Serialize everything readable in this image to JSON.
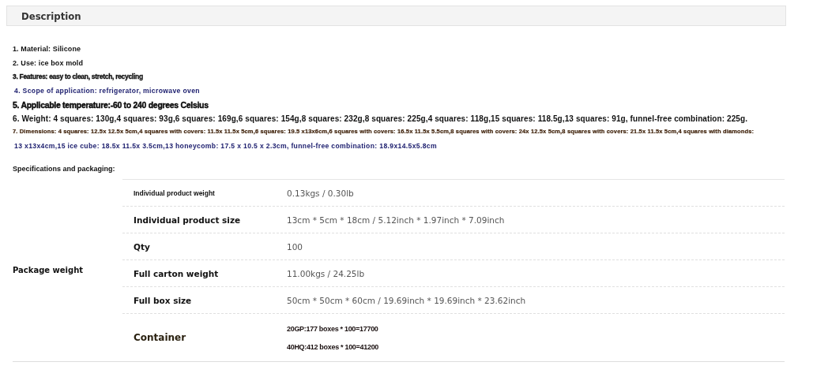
{
  "header": {
    "title": "Description"
  },
  "features": [
    {
      "kind": "plain",
      "text": "1. Material: Silicone"
    },
    {
      "kind": "plain",
      "text": "2. Use: ice box mold"
    },
    {
      "kind": "heavy",
      "text": "3. Features: easy to clean, stretch, recycling"
    },
    {
      "kind": "navy",
      "text": "4. Scope of application: refrigerator, microwave oven"
    },
    {
      "kind": "large",
      "text": "5. Applicable temperature:-60 to 240 degrees Celsius"
    },
    {
      "kind": "regular",
      "text": "6. Weight: 4 squares: 130g,4 squares: 93g,6 squares: 169g,6 squares: 154g,8 squares: 232g,8 squares: 225g,4 squares: 118g,15 squares: 118.5g,13 squares: 91g, funnel-free combination: 225g."
    },
    {
      "kind": "tiny",
      "text": "7. Dimensions: 4 squares: 12.5x 12.5x 5cm,4 squares with covers: 11.5x 11.5x 5cm,6 squares: 19.5 x13x6cm,6 squares with covers: 16.5x 11.5x 5.5cm,8 squares with covers: 24x 12.5x 5cm,8 squares with covers: 21.5x 11.5x 5cm,4 squares with diamonds:"
    },
    {
      "kind": "navy",
      "text": "13 x13x4cm,15 ice cube: 18.5x 11.5x 3.5cm,13 honeycomb: 17.5 x 10.5 x 2.3cm, funnel-free combination: 18.9x14.5x5.8cm"
    }
  ],
  "specs": {
    "heading": "Specifications and packaging:",
    "group_label": "Package weight",
    "rows": [
      {
        "kind": "small",
        "label": "Individual product weight",
        "values": [
          "0.13kgs / 0.30lb"
        ]
      },
      {
        "kind": "normal",
        "label": "Individual product size",
        "values": [
          "13cm * 5cm * 18cm / 5.12inch * 1.97inch * 7.09inch"
        ]
      },
      {
        "kind": "normal",
        "label": "Qty",
        "values": [
          "100"
        ]
      },
      {
        "kind": "normal",
        "label": "Full carton weight",
        "values": [
          "11.00kgs / 24.25lb"
        ]
      },
      {
        "kind": "normal",
        "label": "Full box size",
        "values": [
          "50cm * 50cm * 60cm / 19.69inch * 19.69inch * 23.62inch"
        ]
      },
      {
        "kind": "container",
        "label": "Container",
        "values": [
          "20GP:177 boxes * 100=17700",
          "40HQ:412 boxes * 100=41200"
        ]
      }
    ]
  }
}
